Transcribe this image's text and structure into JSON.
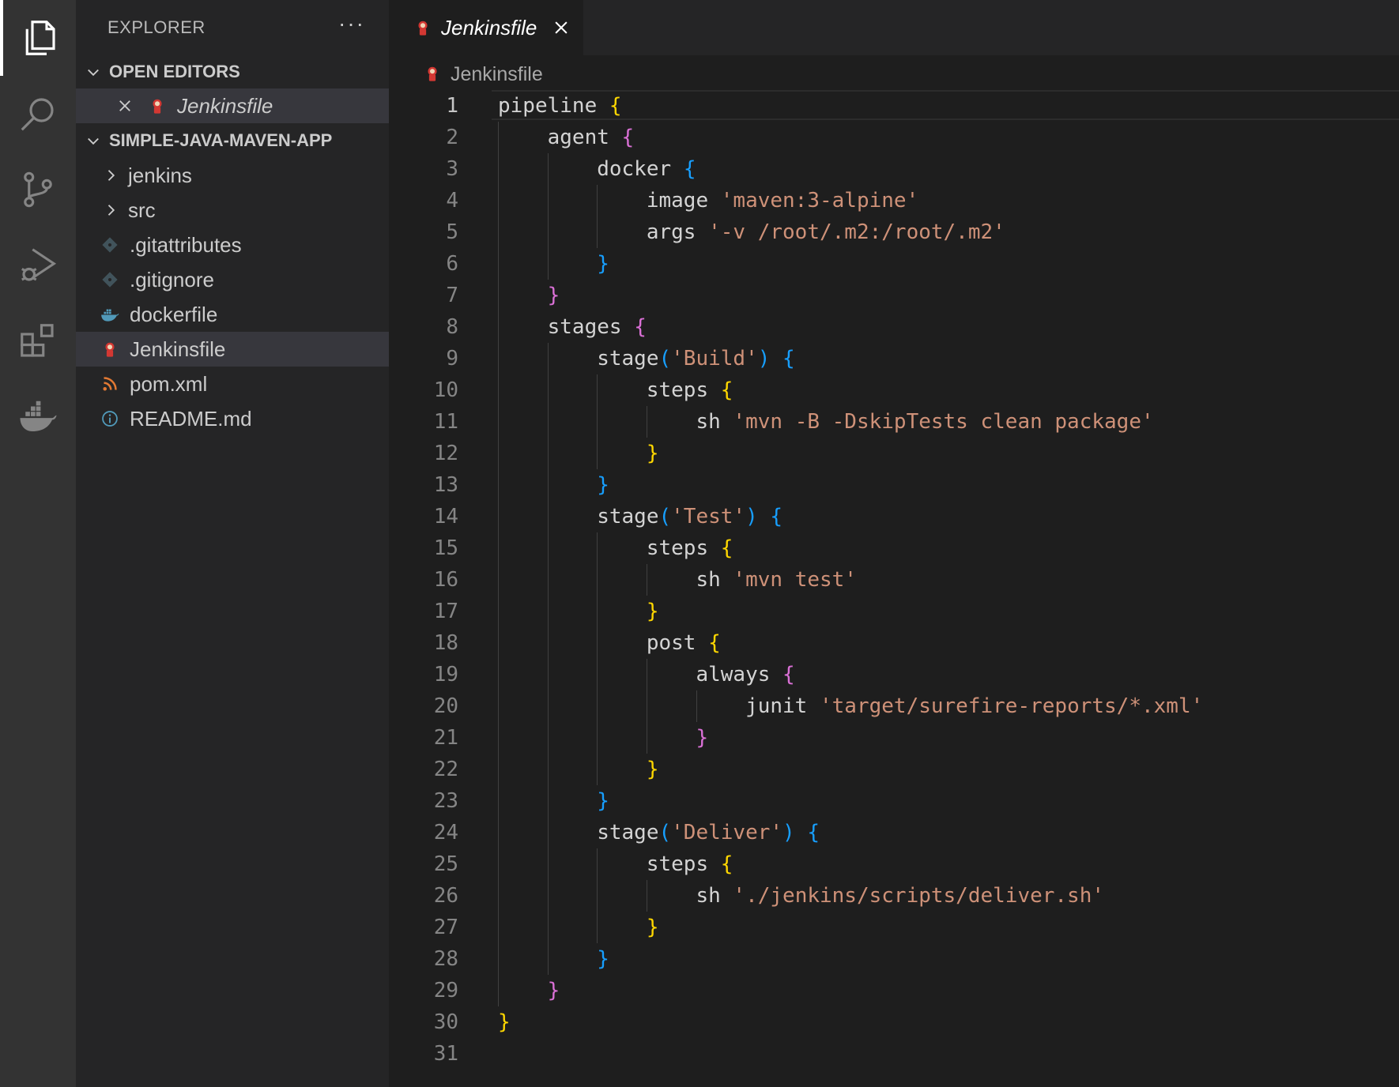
{
  "sidebar": {
    "title": "EXPLORER",
    "more": "···",
    "open_editors": {
      "label": "OPEN EDITORS",
      "items": [
        {
          "name": "Jenkinsfile",
          "icon": "jenkins-icon"
        }
      ]
    },
    "project": {
      "label": "SIMPLE-JAVA-MAVEN-APP",
      "items": [
        {
          "name": "jenkins",
          "type": "folder"
        },
        {
          "name": "src",
          "type": "folder"
        },
        {
          "name": ".gitattributes",
          "icon": "git-icon"
        },
        {
          "name": ".gitignore",
          "icon": "git-icon"
        },
        {
          "name": "dockerfile",
          "icon": "docker-icon"
        },
        {
          "name": "Jenkinsfile",
          "icon": "jenkins-icon",
          "selected": true
        },
        {
          "name": "pom.xml",
          "icon": "rss-icon"
        },
        {
          "name": "README.md",
          "icon": "info-icon"
        }
      ]
    }
  },
  "tab": {
    "label": "Jenkinsfile",
    "icon": "jenkins-icon"
  },
  "breadcrumb": {
    "label": "Jenkinsfile"
  },
  "editor": {
    "active_line": 1,
    "lines": [
      [
        {
          "t": "pipeline ",
          "c": "kw"
        },
        {
          "t": "{",
          "c": "b1"
        }
      ],
      [
        {
          "t": "    agent ",
          "c": "kw"
        },
        {
          "t": "{",
          "c": "b2"
        }
      ],
      [
        {
          "t": "        docker ",
          "c": "kw"
        },
        {
          "t": "{",
          "c": "b3"
        }
      ],
      [
        {
          "t": "            image ",
          "c": "kw"
        },
        {
          "t": "'maven:3-alpine'",
          "c": "str"
        }
      ],
      [
        {
          "t": "            args ",
          "c": "kw"
        },
        {
          "t": "'-v /root/.m2:/root/.m2'",
          "c": "str"
        }
      ],
      [
        {
          "t": "        ",
          "c": "kw"
        },
        {
          "t": "}",
          "c": "b3"
        }
      ],
      [
        {
          "t": "    ",
          "c": "kw"
        },
        {
          "t": "}",
          "c": "b2"
        }
      ],
      [
        {
          "t": "    stages ",
          "c": "kw"
        },
        {
          "t": "{",
          "c": "b2"
        }
      ],
      [
        {
          "t": "        stage",
          "c": "kw"
        },
        {
          "t": "(",
          "c": "b3"
        },
        {
          "t": "'Build'",
          "c": "str"
        },
        {
          "t": ")",
          "c": "b3"
        },
        {
          "t": " ",
          "c": "kw"
        },
        {
          "t": "{",
          "c": "b3"
        }
      ],
      [
        {
          "t": "            steps ",
          "c": "kw"
        },
        {
          "t": "{",
          "c": "b1"
        }
      ],
      [
        {
          "t": "                sh ",
          "c": "kw"
        },
        {
          "t": "'mvn -B -DskipTests clean package'",
          "c": "str"
        }
      ],
      [
        {
          "t": "            ",
          "c": "kw"
        },
        {
          "t": "}",
          "c": "b1"
        }
      ],
      [
        {
          "t": "        ",
          "c": "kw"
        },
        {
          "t": "}",
          "c": "b3"
        }
      ],
      [
        {
          "t": "        stage",
          "c": "kw"
        },
        {
          "t": "(",
          "c": "b3"
        },
        {
          "t": "'Test'",
          "c": "str"
        },
        {
          "t": ")",
          "c": "b3"
        },
        {
          "t": " ",
          "c": "kw"
        },
        {
          "t": "{",
          "c": "b3"
        }
      ],
      [
        {
          "t": "            steps ",
          "c": "kw"
        },
        {
          "t": "{",
          "c": "b1"
        }
      ],
      [
        {
          "t": "                sh ",
          "c": "kw"
        },
        {
          "t": "'mvn test'",
          "c": "str"
        }
      ],
      [
        {
          "t": "            ",
          "c": "kw"
        },
        {
          "t": "}",
          "c": "b1"
        }
      ],
      [
        {
          "t": "            post ",
          "c": "kw"
        },
        {
          "t": "{",
          "c": "b1"
        }
      ],
      [
        {
          "t": "                always ",
          "c": "kw"
        },
        {
          "t": "{",
          "c": "b2"
        }
      ],
      [
        {
          "t": "                    junit ",
          "c": "kw"
        },
        {
          "t": "'target/surefire-reports/*.xml'",
          "c": "str"
        }
      ],
      [
        {
          "t": "                ",
          "c": "kw"
        },
        {
          "t": "}",
          "c": "b2"
        }
      ],
      [
        {
          "t": "            ",
          "c": "kw"
        },
        {
          "t": "}",
          "c": "b1"
        }
      ],
      [
        {
          "t": "        ",
          "c": "kw"
        },
        {
          "t": "}",
          "c": "b3"
        }
      ],
      [
        {
          "t": "        stage",
          "c": "kw"
        },
        {
          "t": "(",
          "c": "b3"
        },
        {
          "t": "'Deliver'",
          "c": "str"
        },
        {
          "t": ")",
          "c": "b3"
        },
        {
          "t": " ",
          "c": "kw"
        },
        {
          "t": "{",
          "c": "b3"
        }
      ],
      [
        {
          "t": "            steps ",
          "c": "kw"
        },
        {
          "t": "{",
          "c": "b1"
        }
      ],
      [
        {
          "t": "                sh ",
          "c": "kw"
        },
        {
          "t": "'./jenkins/scripts/deliver.sh'",
          "c": "str"
        }
      ],
      [
        {
          "t": "            ",
          "c": "kw"
        },
        {
          "t": "}",
          "c": "b1"
        }
      ],
      [
        {
          "t": "        ",
          "c": "kw"
        },
        {
          "t": "}",
          "c": "b3"
        }
      ],
      [
        {
          "t": "    ",
          "c": "kw"
        },
        {
          "t": "}",
          "c": "b2"
        }
      ],
      [
        {
          "t": "}",
          "c": "b1"
        }
      ],
      []
    ]
  }
}
